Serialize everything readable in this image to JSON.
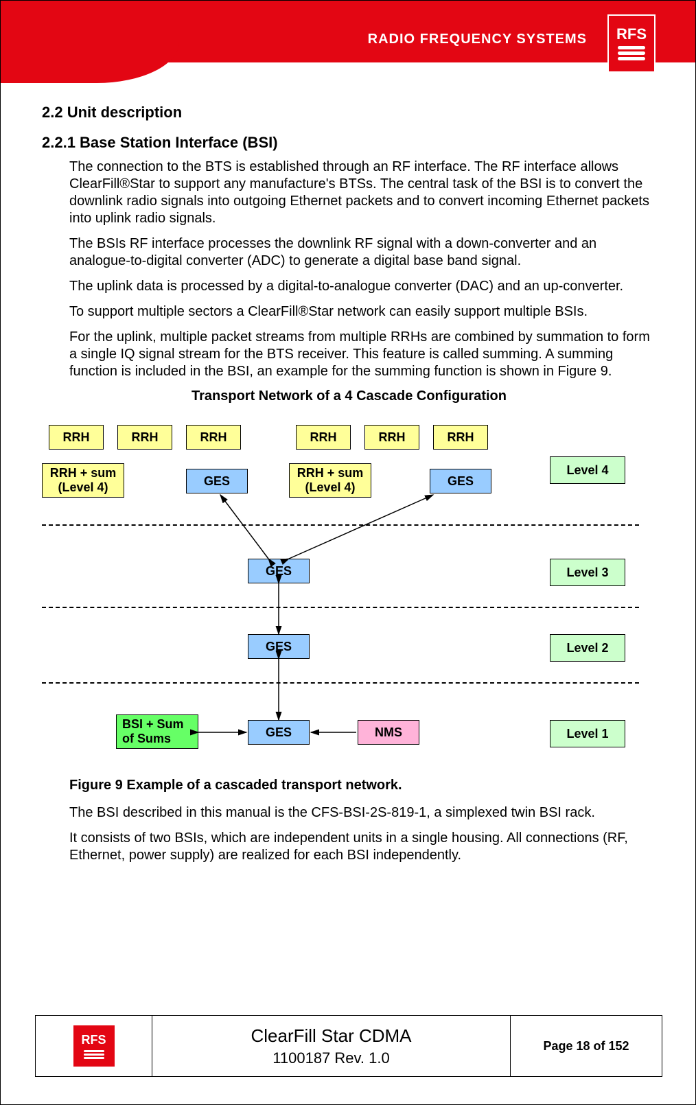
{
  "header": {
    "brand_text": "RADIO FREQUENCY SYSTEMS",
    "logo_text": "RFS"
  },
  "section_2_2": {
    "number_title": "2.2   Unit description",
    "sub_2_2_1_title": "2.2.1   Base Station Interface (BSI)",
    "para1": "The connection to the BTS is established through an RF interface. The RF interface allows ClearFill®Star to support any manufacture's BTSs. The central task of the BSI is to convert the downlink radio signals into outgoing Ethernet packets and to convert incoming Ethernet packets into uplink radio signals.",
    "para2": "The BSIs RF interface processes the downlink RF signal with a down-converter and an analogue-to-digital converter (ADC) to generate a digital base band signal.",
    "para3": "The uplink data is processed by a digital-to-analogue converter (DAC) and an up-converter.",
    "para4": "To support multiple sectors a ClearFill®Star network can easily support multiple BSIs.",
    "para5": "For the uplink, multiple packet streams from multiple RRHs are combined by summation to form a single IQ signal stream for the BTS receiver. This feature is called summing. A summing function is included in the BSI, an example for the summing function is shown in Figure 9."
  },
  "diagram": {
    "title": "Transport Network of a 4 Cascade Configuration",
    "rrh": "RRH",
    "rrh_sum": "RRH + sum\n(Level 4)",
    "ges": "GES",
    "nms": "NMS",
    "bsi": "BSI + Sum of Sums",
    "level4": "Level 4",
    "level3": "Level 3",
    "level2": "Level 2",
    "level1": "Level 1",
    "figure_caption": "Figure 9 Example of a cascaded transport network."
  },
  "after_diagram": {
    "para1": "The BSI described in this manual is the CFS-BSI-2S-819-1, a simplexed twin BSI rack.",
    "para2": "It consists of two BSIs, which are independent units in a single housing. All connections (RF, Ethernet, power supply) are realized for each BSI independently."
  },
  "footer": {
    "logo_text": "RFS",
    "product": "ClearFill Star CDMA",
    "revision": "1100187 Rev. 1.0",
    "page": "Page 18 of 152"
  }
}
